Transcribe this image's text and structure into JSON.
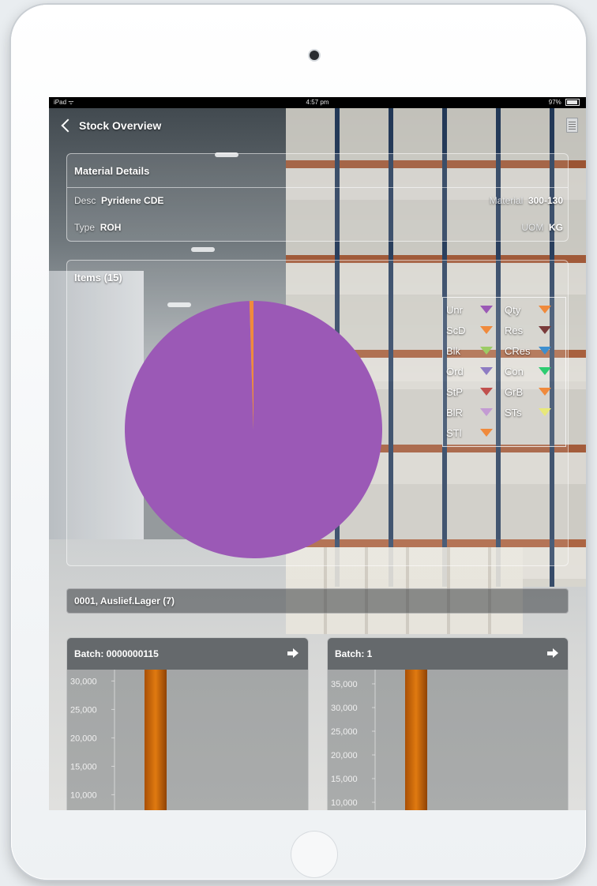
{
  "status_bar": {
    "carrier": "iPad ᯤ",
    "time": "4:57 pm",
    "battery": "97%"
  },
  "nav": {
    "back_label": "Stock Overview"
  },
  "material_details": {
    "title": "Material Details",
    "desc_label": "Desc",
    "desc_value": "Pyridene CDE",
    "material_label": "Material",
    "material_value": "300-130",
    "type_label": "Type",
    "type_value": "ROH",
    "uom_label": "UOM",
    "uom_value": "KG"
  },
  "items_panel": {
    "title": "Items (15)"
  },
  "legend": [
    {
      "label": "Unr",
      "color": "#9b59b6"
    },
    {
      "label": "Qty",
      "color": "#f08a3c"
    },
    {
      "label": "ScD",
      "color": "#f08a3c"
    },
    {
      "label": "Res",
      "color": "#7a3b3b"
    },
    {
      "label": "Blk",
      "color": "#9ccc65"
    },
    {
      "label": "CRes",
      "color": "#3d8fcf"
    },
    {
      "label": "Ord",
      "color": "#8e7cc3"
    },
    {
      "label": "Con",
      "color": "#2ecc71"
    },
    {
      "label": "StP",
      "color": "#c0504d"
    },
    {
      "label": "GrB",
      "color": "#f08a3c"
    },
    {
      "label": "BlR",
      "color": "#c39bd3"
    },
    {
      "label": "STs",
      "color": "#e8e87a"
    },
    {
      "label": "STl",
      "color": "#f08a3c"
    }
  ],
  "storage_location": {
    "label": "0001, Auslief.Lager (7)"
  },
  "batches": [
    {
      "title": "Batch: 0000000115",
      "ticks": [
        "30,000",
        "25,000",
        "20,000",
        "15,000",
        "10,000"
      ]
    },
    {
      "title": "Batch: 1",
      "ticks": [
        "35,000",
        "30,000",
        "25,000",
        "20,000",
        "15,000",
        "10,000"
      ]
    }
  ],
  "chart_data": [
    {
      "type": "pie",
      "title": "Items (15)",
      "categories": [
        "Unr",
        "Qty"
      ],
      "values": [
        99.5,
        0.5
      ],
      "colors": [
        "#9b59b6",
        "#f08a3c"
      ]
    },
    {
      "type": "bar",
      "title": "Batch: 0000000115",
      "ylim": [
        7000,
        32000
      ],
      "values": [
        40000
      ],
      "color": "#e07a10"
    },
    {
      "type": "bar",
      "title": "Batch: 1",
      "ylim": [
        8000,
        38000
      ],
      "values": [
        40000
      ],
      "color": "#e07a10"
    }
  ]
}
